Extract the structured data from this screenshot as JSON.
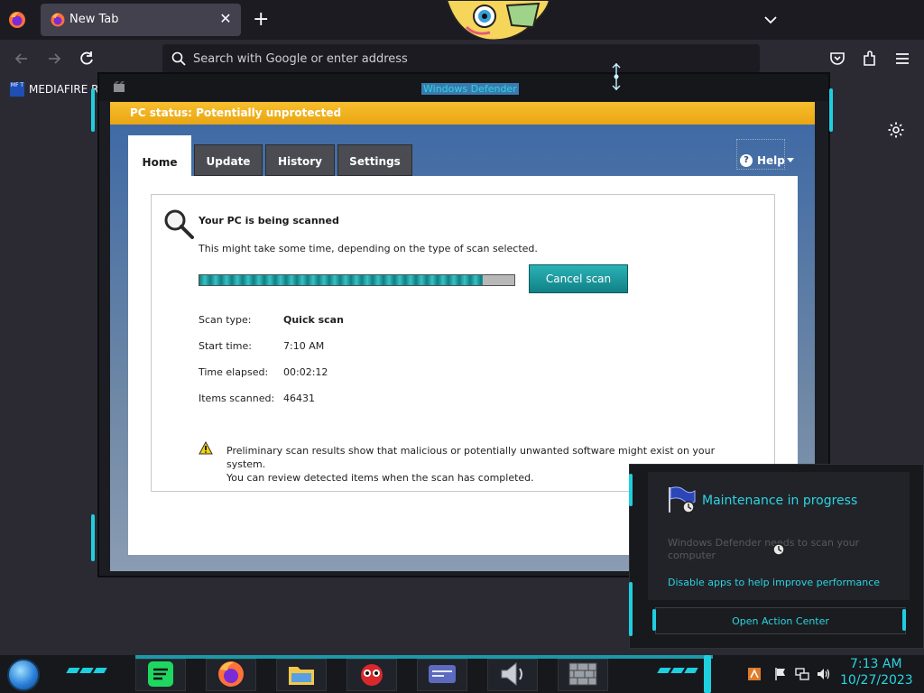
{
  "browser": {
    "tab_title": "New Tab",
    "url_placeholder": "Search with Google or enter address",
    "bookmark": {
      "icon_text": "MF T",
      "label": "MEDIAFIRE R"
    }
  },
  "defender": {
    "window_title": "Windows Defender",
    "status": "PC status: Potentially unprotected",
    "tabs": [
      "Home",
      "Update",
      "History",
      "Settings"
    ],
    "active_tab": "Home",
    "help_label": "Help",
    "scan_title": "Your PC is being scanned",
    "scan_subtitle": "This might take some time, depending on the type of scan selected.",
    "progress": 0.9,
    "cancel_label": "Cancel scan",
    "details": [
      {
        "label": "Scan type:",
        "value": "Quick scan",
        "bold": true
      },
      {
        "label": "Start time:",
        "value": "7:10 AM",
        "bold": false
      },
      {
        "label": "Time elapsed:",
        "value": "00:02:12",
        "bold": false
      },
      {
        "label": "Items scanned:",
        "value": "46431",
        "bold": false
      }
    ],
    "warning_line1": "Preliminary scan results show that malicious or potentially unwanted software might exist on your system.",
    "warning_line2": "You can review detected items when the scan has completed."
  },
  "action_center": {
    "title": "Maintenance in progress",
    "description": "Windows Defender needs to scan your computer",
    "link": "Disable apps to help improve performance",
    "button": "Open Action Center"
  },
  "taskbar": {
    "time": "7:13 AM",
    "date": "10/27/2023"
  },
  "colors": {
    "accent": "#2bd4e0",
    "status_yellow": "#f5b81e",
    "cancel_teal": "#1a9ea2"
  }
}
